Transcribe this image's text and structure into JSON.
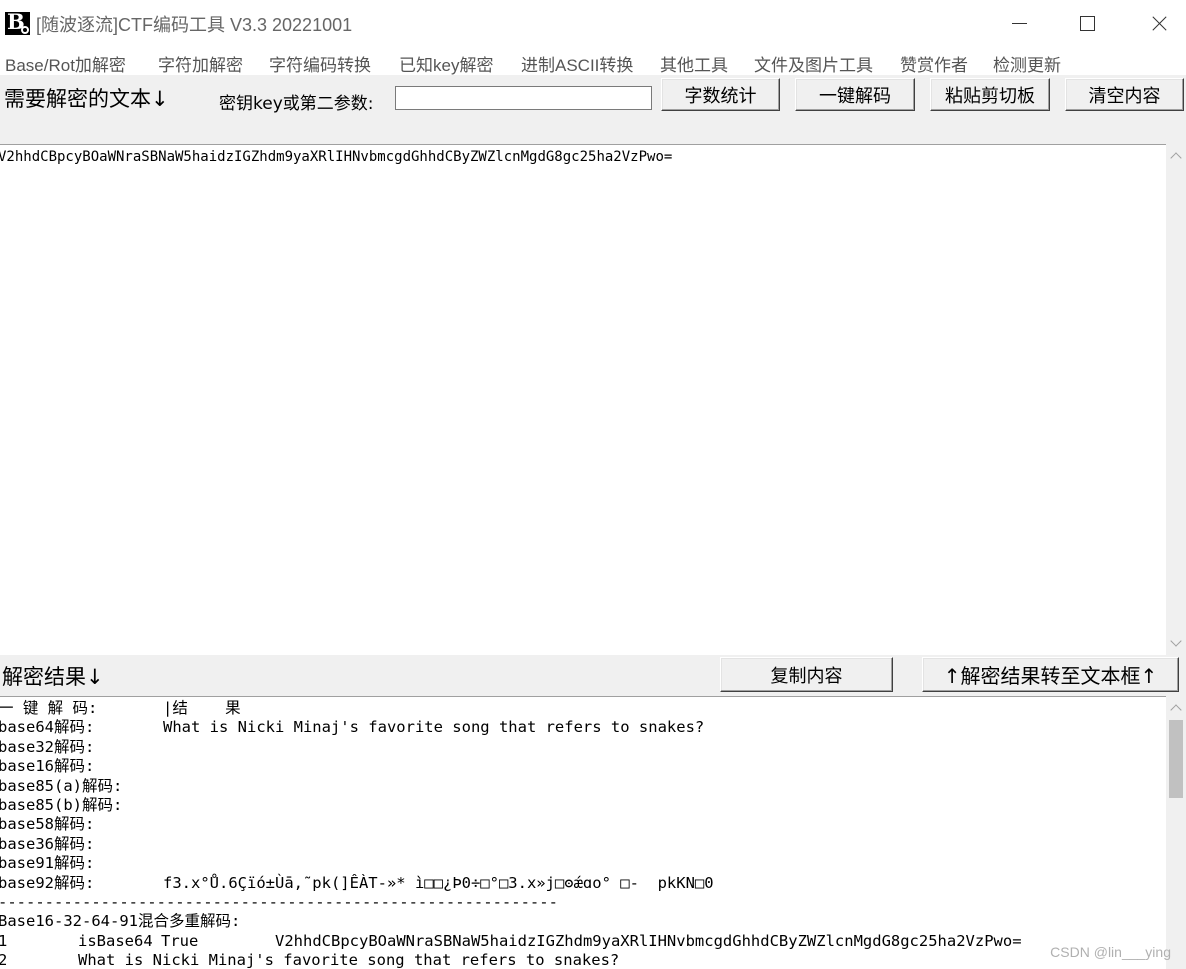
{
  "window": {
    "title": "[随波逐流]CTF编码工具 V3.3 20221001"
  },
  "menu": {
    "items": [
      "Base/Rot加解密",
      "字符加解密",
      "字符编码转换",
      "已知key解密",
      "进制ASCII转换",
      "其他工具",
      "文件及图片工具",
      "赞赏作者",
      "检测更新"
    ]
  },
  "toolbar": {
    "need_label": "需要解密的文本↓",
    "key_label": "密钥key或第二参数:",
    "key_value": "",
    "count_button": "字数统计",
    "decode_button": "一键解码",
    "paste_button": "粘贴剪切板",
    "clear_button": "清空内容"
  },
  "input": {
    "text": "V2hhdCBpcyBOaWNraSBNaW5haidzIGZhdm9yaXRlIHNvbmcgdGhhdCByZWZlcnMgdG8gc25ha2VzPwo="
  },
  "result": {
    "label": "解密结果↓",
    "copy_button": "复制内容",
    "transfer_button": "↑解密结果转至文本框↑",
    "header": {
      "col1": "一 键 解 码:",
      "col2": "|结    果"
    },
    "rows": [
      {
        "name": "base64解码:",
        "value": "What is Nicki Minaj's favorite song that refers to snakes?"
      },
      {
        "name": "base32解码:",
        "value": ""
      },
      {
        "name": "base16解码:",
        "value": ""
      },
      {
        "name": "base85(a)解码:",
        "value": ""
      },
      {
        "name": "base85(b)解码:",
        "value": ""
      },
      {
        "name": "base58解码:",
        "value": ""
      },
      {
        "name": "base36解码:",
        "value": ""
      },
      {
        "name": "base91解码:",
        "value": ""
      },
      {
        "name": "base92解码:",
        "value": "f3.x°Ů.6Çïó±Ùā,˜pk(]ÊÀT-»* ì□□¿Þ0÷□°□3.x»j□ʘǽɑo° □-  pkKN□0"
      }
    ],
    "divider": "------------------------------------------------------------",
    "mixed_label": "Base16-32-64-91混合多重解码:",
    "mixed_rows": [
      {
        "index": "1",
        "method": "isBase64",
        "flag": "True",
        "value": "V2hhdCBpcyBOaWNraSBNaW5haidzIGZhdm9yaXRlIHNvbmcgdGhhdCByZWZlcnMgdG8gc25ha2VzPwo="
      },
      {
        "index": "2",
        "method": "What is Nicki Minaj's favorite song that refers to snakes?",
        "flag": "",
        "value": ""
      }
    ]
  },
  "watermark": "CSDN @lin___ying",
  "colors": {
    "window_bg": "#f0f0f0",
    "text_bg": "#ffffff",
    "menu_text": "#555555"
  }
}
